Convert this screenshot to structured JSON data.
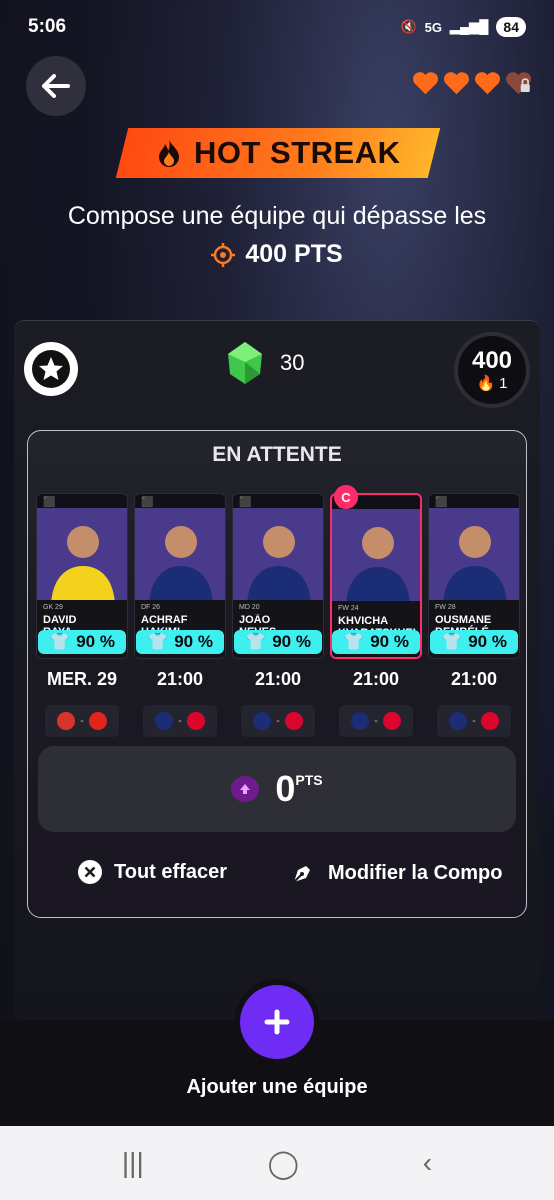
{
  "status_bar": {
    "time": "5:06",
    "battery": "84",
    "network": "5G"
  },
  "hearts": {
    "count": 4,
    "locked_index": 3,
    "color": "#ff6b1a"
  },
  "banner": {
    "title": "HOT STREAK"
  },
  "goal": {
    "subtitle": "Compose une équipe qui dépasse les",
    "target": "400 PTS"
  },
  "stats": {
    "gems": "30",
    "score": "400",
    "streak": "1"
  },
  "team": {
    "status": "EN ATTENTE",
    "players": [
      {
        "first": "DAVID",
        "last": "RAYA",
        "meta": "GK  29",
        "pct": "90 %",
        "time": "MER. 29",
        "home": "ATM",
        "away": "ARS",
        "kit": "#f2d21c",
        "captain": false
      },
      {
        "first": "ACHRAF",
        "last": "HAKIMI",
        "meta": "DF  26",
        "pct": "90 %",
        "time": "21:00",
        "home": "PSG",
        "away": "FCB",
        "kit": "#1b2d77",
        "captain": false
      },
      {
        "first": "JOÃO",
        "last": "NEVES",
        "meta": "MD  20",
        "pct": "90 %",
        "time": "21:00",
        "home": "PSG",
        "away": "FCB",
        "kit": "#1b2d77",
        "captain": false
      },
      {
        "first": "KHVICHA",
        "last": "KVARATSKHELIA",
        "meta": "FW  24",
        "pct": "90 %",
        "time": "21:00",
        "home": "PSG",
        "away": "FCB",
        "kit": "#1b2d77",
        "captain": true
      },
      {
        "first": "OUSMANE",
        "last": "DEMBÉLÉ",
        "meta": "FW  28",
        "pct": "90 %",
        "time": "21:00",
        "home": "PSG",
        "away": "FCB",
        "kit": "#1b2d77",
        "captain": false
      }
    ],
    "captain_label": "C",
    "points": "0",
    "points_unit": "PTS"
  },
  "actions": {
    "clear": "Tout effacer",
    "edit": "Modifier la Compo"
  },
  "add_team": {
    "label": "Ajouter une équipe"
  },
  "colors": {
    "accent": "#6e2cf5",
    "cyan": "#3df0ef",
    "captain": "#ff2b6a",
    "banner": "#ff7a1c"
  }
}
